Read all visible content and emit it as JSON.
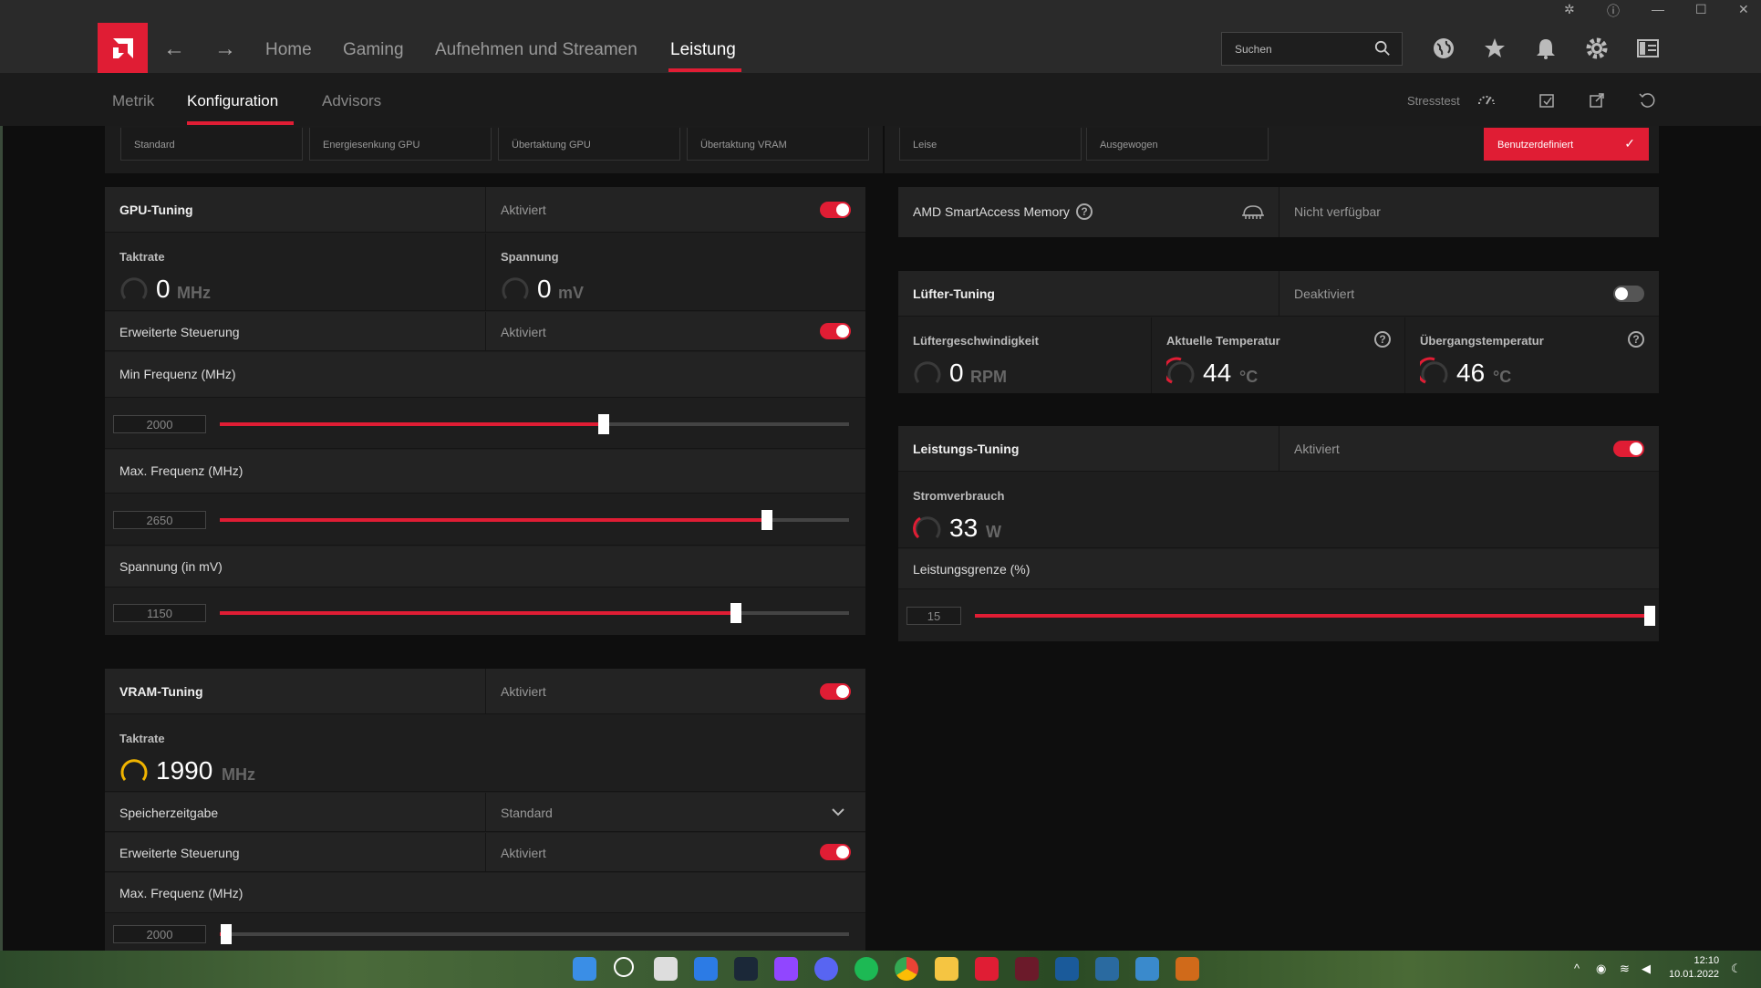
{
  "nav": {
    "home": "Home",
    "gaming": "Gaming",
    "record": "Aufnehmen und Streamen",
    "performance": "Leistung",
    "search_placeholder": "Suchen"
  },
  "subnav": {
    "metrics": "Metrik",
    "config": "Konfiguration",
    "advisors": "Advisors",
    "stresstest": "Stresstest"
  },
  "presets": {
    "standard": "Standard",
    "energy": "Energiesenkung GPU",
    "oc_gpu": "Übertaktung GPU",
    "oc_vram": "Übertaktung VRAM",
    "quiet": "Leise",
    "balanced": "Ausgewogen",
    "custom": "Benutzerdefiniert"
  },
  "gpu": {
    "title": "GPU-Tuning",
    "status": "Aktiviert",
    "enabled": true,
    "clock_label": "Taktrate",
    "clock_value": "0",
    "clock_unit": "MHz",
    "volt_label": "Spannung",
    "volt_value": "0",
    "volt_unit": "mV",
    "adv_label": "Erweiterte Steuerung",
    "adv_status": "Aktiviert",
    "adv_enabled": true,
    "min_freq_label": "Min Frequenz (MHz)",
    "min_freq_value": "2000",
    "min_freq_pct": 61,
    "max_freq_label": "Max. Frequenz (MHz)",
    "max_freq_value": "2650",
    "max_freq_pct": 87,
    "volt_adj_label": "Spannung (in mV)",
    "volt_adj_value": "1150",
    "volt_adj_pct": 82
  },
  "vram": {
    "title": "VRAM-Tuning",
    "status": "Aktiviert",
    "enabled": true,
    "clock_label": "Taktrate",
    "clock_value": "1990",
    "clock_unit": "MHz",
    "timing_label": "Speicherzeitgabe",
    "timing_value": "Standard",
    "adv_label": "Erweiterte Steuerung",
    "adv_status": "Aktiviert",
    "adv_enabled": true,
    "max_freq_label": "Max. Frequenz (MHz)",
    "max_freq_value": "2000",
    "max_freq_pct": 1
  },
  "sam": {
    "label": "AMD SmartAccess Memory",
    "status": "Nicht verfügbar"
  },
  "fan": {
    "title": "Lüfter-Tuning",
    "status": "Deaktiviert",
    "enabled": false,
    "speed_label": "Lüftergeschwindigkeit",
    "speed_value": "0",
    "speed_unit": "RPM",
    "temp_label": "Aktuelle Temperatur",
    "temp_value": "44",
    "temp_unit": "°C",
    "junction_label": "Übergangstemperatur",
    "junction_value": "46",
    "junction_unit": "°C"
  },
  "power": {
    "title": "Leistungs-Tuning",
    "status": "Aktiviert",
    "enabled": true,
    "usage_label": "Stromverbrauch",
    "usage_value": "33",
    "usage_unit": "W",
    "limit_label": "Leistungsgrenze (%)",
    "limit_value": "15",
    "limit_pct": 100
  },
  "taskbar": {
    "time": "12:10",
    "date": "10.01.2022"
  },
  "colors": {
    "accent": "#e01d34",
    "gauge_yellow": "#f0b400"
  }
}
